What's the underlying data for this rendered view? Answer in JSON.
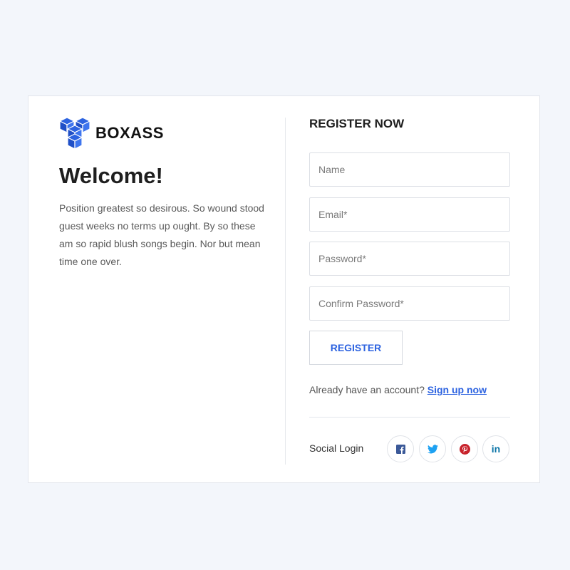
{
  "brand": {
    "name": "BOXASS",
    "logo_icon": "cubes-logo-icon",
    "color": "#2d63e0"
  },
  "intro": {
    "heading": "Welcome!",
    "text": "Position greatest so desirous. So wound stood guest weeks no terms up ought. By so these am so rapid blush songs begin. Nor but mean time one over."
  },
  "form": {
    "title": "REGISTER NOW",
    "name_placeholder": "Name",
    "email_placeholder": "Email*",
    "password_placeholder": "Password*",
    "confirm_placeholder": "Confirm Password*",
    "submit_label": "REGISTER"
  },
  "account": {
    "prompt": "Already have an account?",
    "link": "Sign up now"
  },
  "social": {
    "label": "Social Login",
    "icons": [
      {
        "name": "facebook-icon",
        "color": "#3b5998"
      },
      {
        "name": "twitter-icon",
        "color": "#1da1f2"
      },
      {
        "name": "pinterest-icon",
        "color": "#c8232c"
      },
      {
        "name": "linkedin-icon",
        "color": "#0e76a8",
        "text": "in"
      }
    ]
  }
}
